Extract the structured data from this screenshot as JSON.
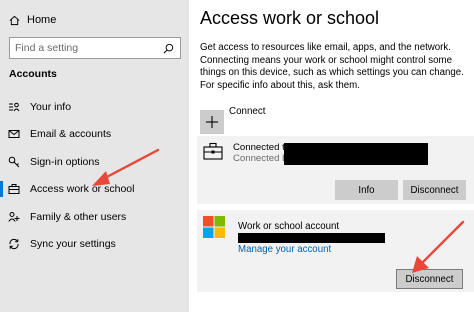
{
  "sidebar": {
    "home": "Home",
    "search_placeholder": "Find a setting",
    "section": "Accounts",
    "items": [
      {
        "label": "Your info",
        "icon": "person-icon"
      },
      {
        "label": "Email & accounts",
        "icon": "mail-icon"
      },
      {
        "label": "Sign-in options",
        "icon": "key-icon"
      },
      {
        "label": "Access work or school",
        "icon": "briefcase-icon",
        "active": true
      },
      {
        "label": "Family & other users",
        "icon": "family-icon"
      },
      {
        "label": "Sync your settings",
        "icon": "sync-icon"
      }
    ]
  },
  "main": {
    "title": "Access work or school",
    "description": "Get access to resources like email, apps, and the network. Connecting means your work or school might control some things on this device, such as which settings you can change. For specific info about this, ask them.",
    "connect_label": "Connect",
    "connection": {
      "line1": "Connected to",
      "line2": "Connected by",
      "info_button": "Info",
      "disconnect_button": "Disconnect"
    },
    "account": {
      "label": "Work or school account",
      "manage_link": "Manage your account",
      "disconnect_button": "Disconnect"
    }
  },
  "colors": {
    "sidebar_bg": "#e6e6e6",
    "accent": "#0078d7",
    "link": "#0063b1",
    "annotation_arrow": "#e8473a"
  }
}
